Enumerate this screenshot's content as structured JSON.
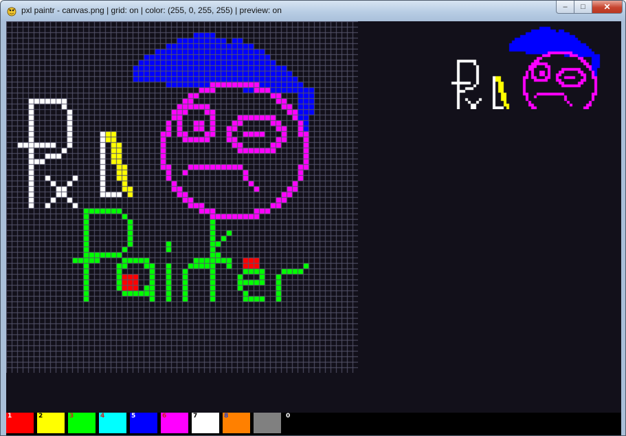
{
  "window": {
    "title": "pxl paintr - canvas.png | grid: on | color: (255, 0, 255, 255) | preview: on",
    "buttons": {
      "minimize": "–",
      "maximize": "□",
      "close": "✕"
    }
  },
  "canvas": {
    "grid_on": true,
    "grid_size": 64,
    "background_color": "#12101a",
    "grid_color": "#55546a",
    "selected_color": "#ff00ff",
    "preview_on": true
  },
  "palette": [
    {
      "key": "1",
      "color": "#ff0000",
      "label_color": "#ffffff"
    },
    {
      "key": "2",
      "color": "#ffff00",
      "label_color": "#000000"
    },
    {
      "key": "3",
      "color": "#00ff00",
      "label_color": "#cc2222"
    },
    {
      "key": "4",
      "color": "#00ffff",
      "label_color": "#cc2222"
    },
    {
      "key": "5",
      "color": "#0000ff",
      "label_color": "#ffffff"
    },
    {
      "key": "6",
      "color": "#ff00ff",
      "label_color": "#cc2222"
    },
    {
      "key": "7",
      "color": "#ffffff",
      "label_color": "#000000"
    },
    {
      "key": "8",
      "color": "#ff8000",
      "label_color": "#2244cc"
    },
    {
      "key": "9",
      "color": "#808080",
      "label_color": "#808080"
    },
    {
      "key": "0",
      "color": "#000000",
      "label_color": "#ffffff"
    }
  ]
}
